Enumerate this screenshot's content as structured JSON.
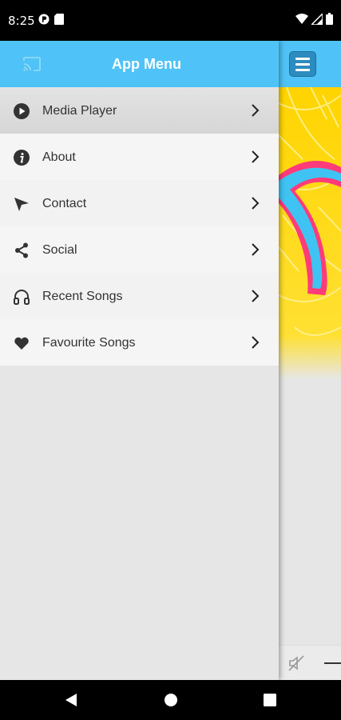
{
  "status_bar": {
    "time": "8:25"
  },
  "drawer": {
    "title": "App Menu",
    "items": [
      {
        "label": "Media Player",
        "icon": "play-circle-icon"
      },
      {
        "label": "About",
        "icon": "info-icon"
      },
      {
        "label": "Contact",
        "icon": "send-icon"
      },
      {
        "label": "Social",
        "icon": "share-icon"
      },
      {
        "label": "Recent Songs",
        "icon": "headphones-icon"
      },
      {
        "label": "Favourite Songs",
        "icon": "heart-icon"
      }
    ]
  },
  "colors": {
    "header_bg": "#4fc3f7",
    "drawer_bg": "#e6e6e6",
    "menu_text": "#333333"
  }
}
